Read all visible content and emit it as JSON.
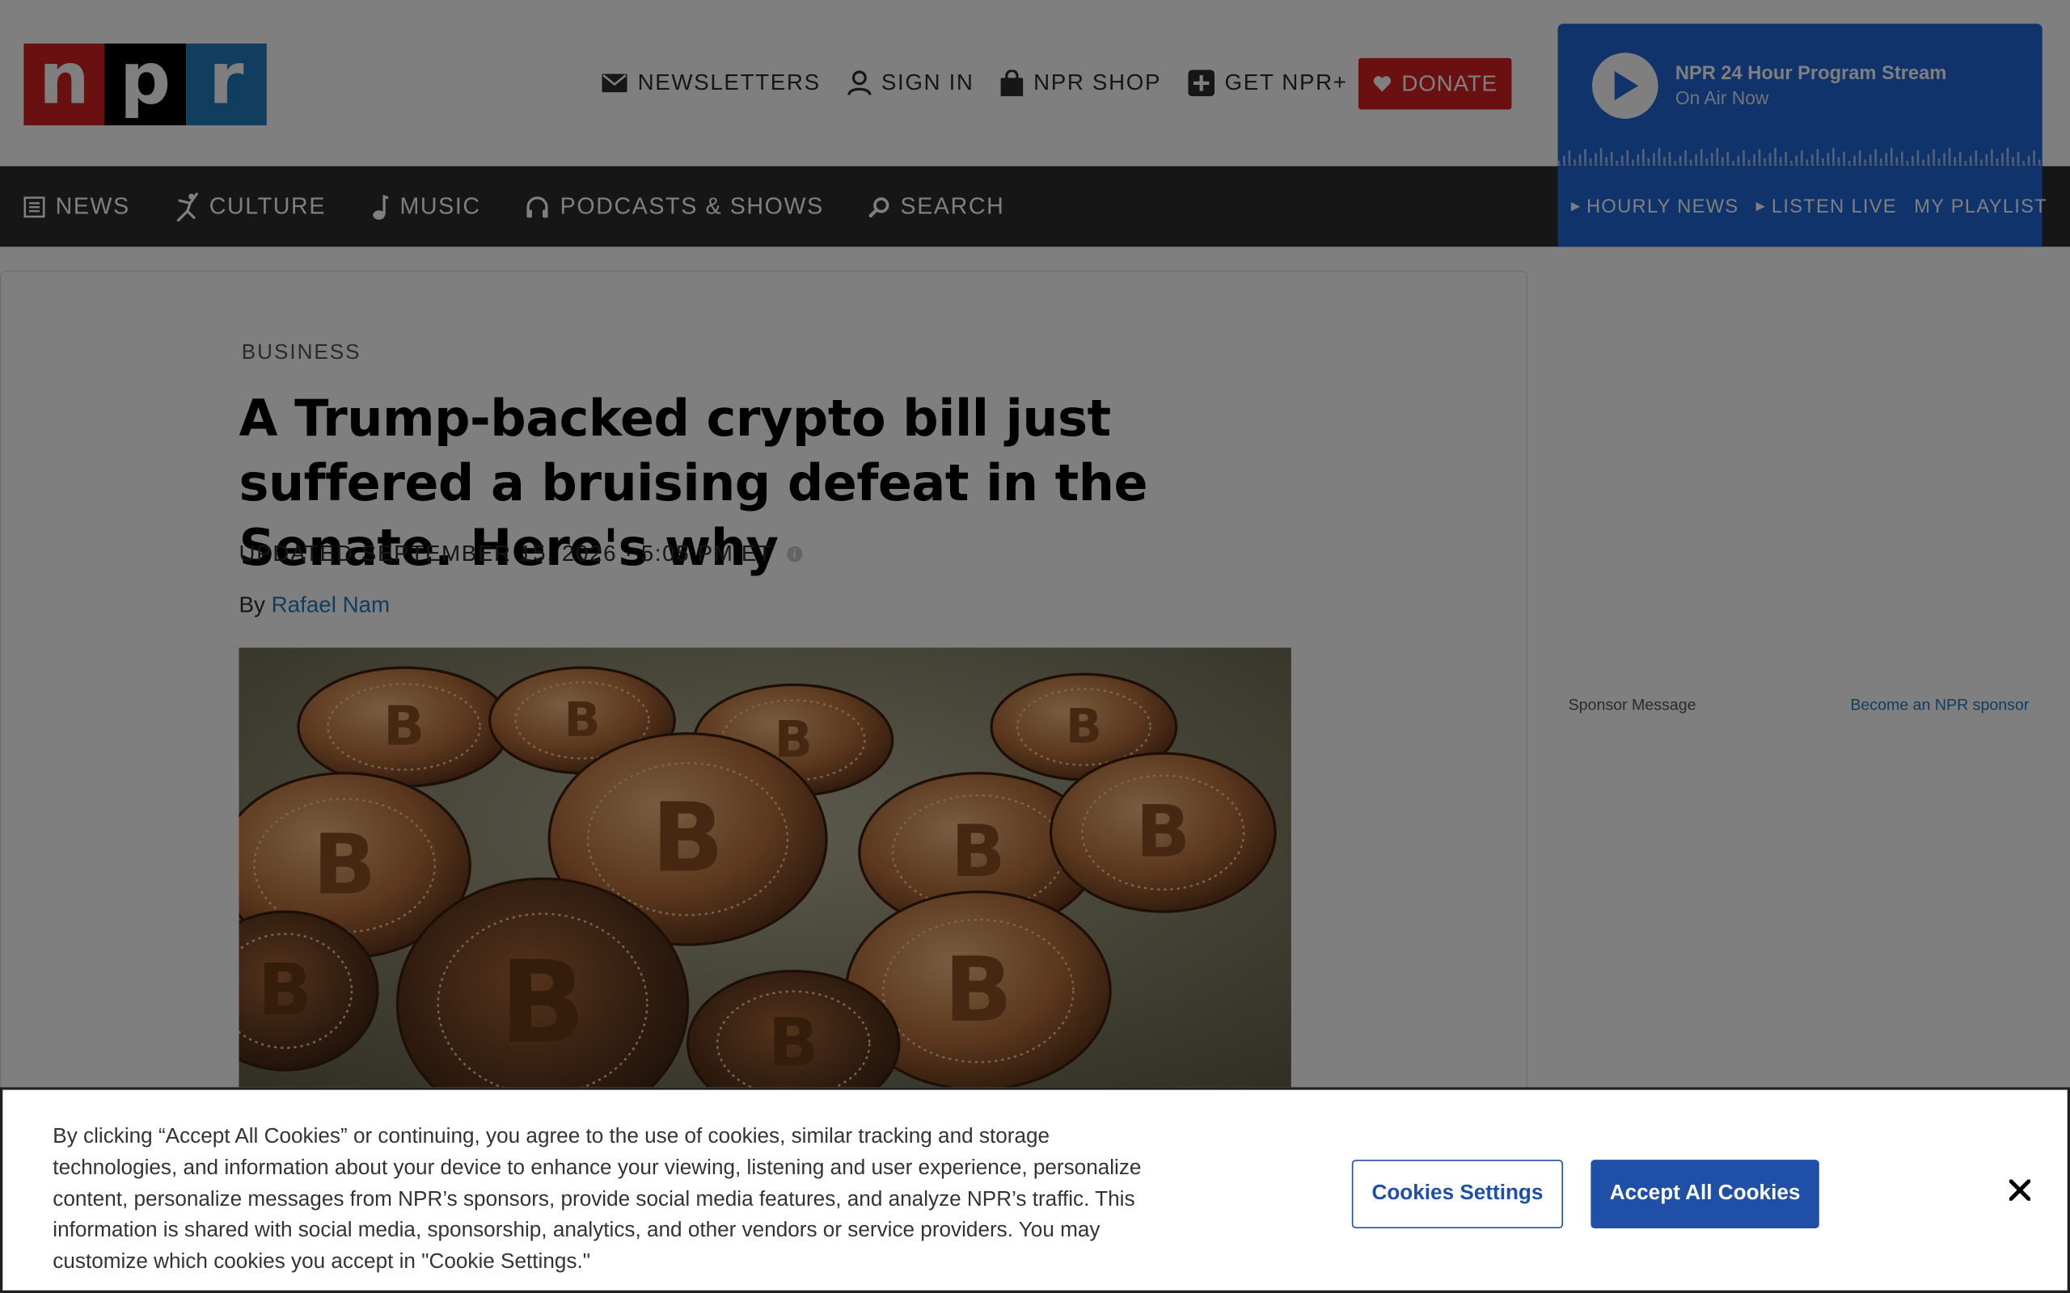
{
  "logo": {
    "letters": [
      "n",
      "p",
      "r"
    ],
    "colors": [
      "#d62021",
      "#000000",
      "#237bbd"
    ]
  },
  "utility": {
    "newsletters": "NEWSLETTERS",
    "sign_in": "SIGN IN",
    "shop": "NPR SHOP",
    "plus": "GET NPR+",
    "donate": "DONATE"
  },
  "player": {
    "title": "NPR 24 Hour Program Stream",
    "subtitle": "On Air Now",
    "links": {
      "hourly": "HOURLY NEWS",
      "live": "LISTEN LIVE",
      "playlist": "MY PLAYLIST"
    }
  },
  "nav": {
    "news": "NEWS",
    "culture": "CULTURE",
    "music": "MUSIC",
    "podcasts": "PODCASTS & SHOWS",
    "search": "SEARCH"
  },
  "article": {
    "slug": "BUSINESS",
    "headline": "A Trump-backed crypto bill just suffered a bruising defeat in the Senate. Here's why",
    "dateline": "UPDATED SEPTEMBER 15, 2026 · 5:05 PM ET",
    "by": "By",
    "author": "Rafael Nam",
    "image_subject": "bitcoin-coins-photo"
  },
  "sponsor": {
    "label": "Sponsor Message",
    "link": "Become an NPR sponsor"
  },
  "cookie": {
    "text": "By clicking “Accept All Cookies” or continuing, you agree to the use of cookies, similar tracking and storage technologies, and information about your device to enhance your viewing, listening and user experience, personalize content, personalize messages from NPR’s sponsors, provide social media features, and analyze NPR’s traffic. This information is shared with social media, sponsorship, analytics, and other vendors or service providers. You may customize which cookies you accept in \"Cookie Settings.\"",
    "settings_button": "Cookies Settings",
    "accept_button": "Accept All Cookies"
  },
  "colors": {
    "accent_blue": "#1f4fa6",
    "npr_red": "#d62021",
    "player_blue": "#1f66d4"
  }
}
